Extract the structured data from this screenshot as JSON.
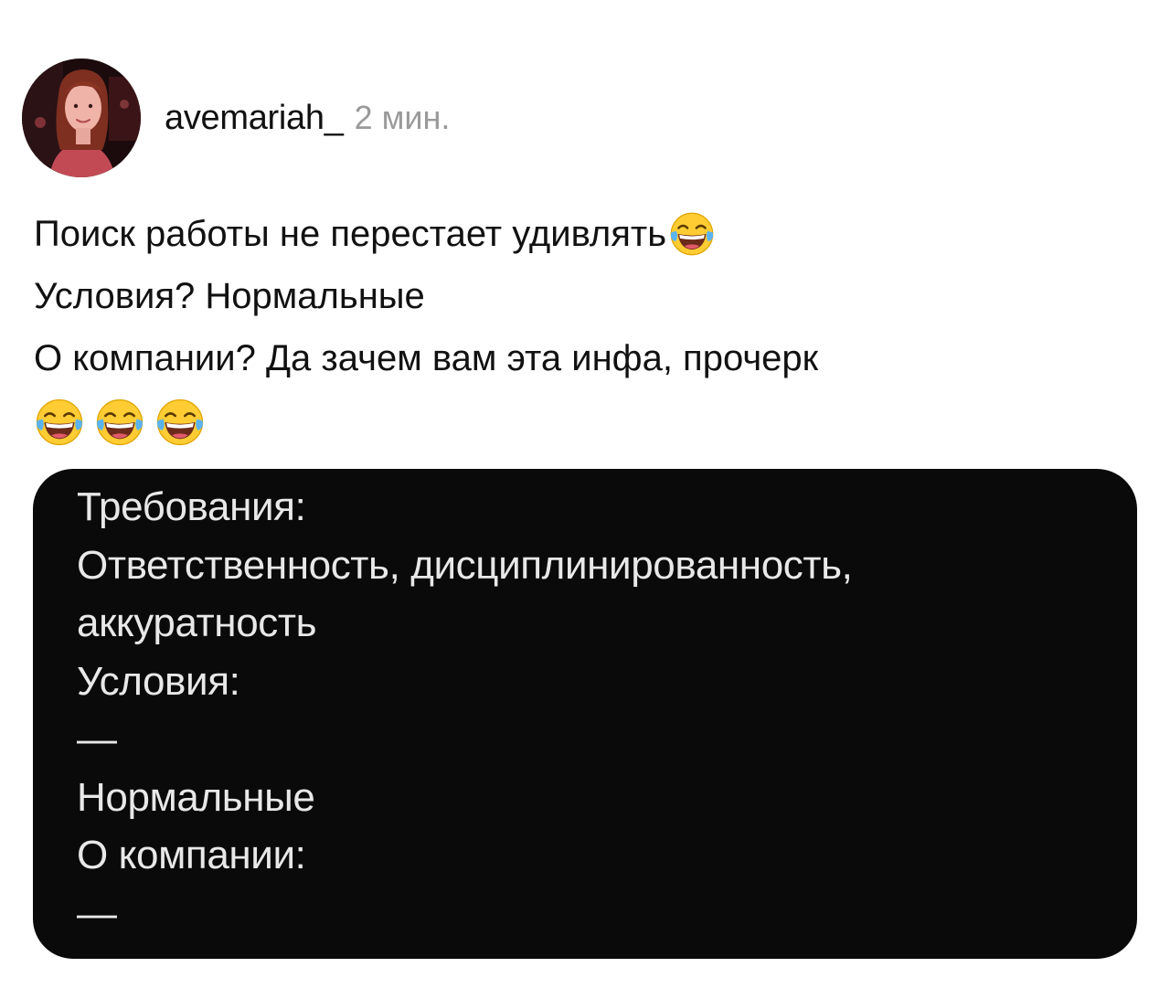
{
  "post": {
    "username": "avemariah_",
    "time": "2 мин.",
    "lines": [
      "Поиск работы не перестает удивлять",
      "Условия? Нормальные",
      "О компании? Да зачем вам эта инфа, прочерк"
    ],
    "emoji_name": "face-with-tears-of-joy-icon"
  },
  "screenshot": {
    "lines": [
      "Требования:",
      "Ответственность, дисциплинированность,",
      "аккуратность",
      "Условия:",
      "—",
      "Нормальные",
      "О компании:",
      "—"
    ]
  },
  "colors": {
    "card_bg": "#0a0a0a",
    "card_text": "#e8e8e8",
    "time": "#9a9a9a"
  }
}
